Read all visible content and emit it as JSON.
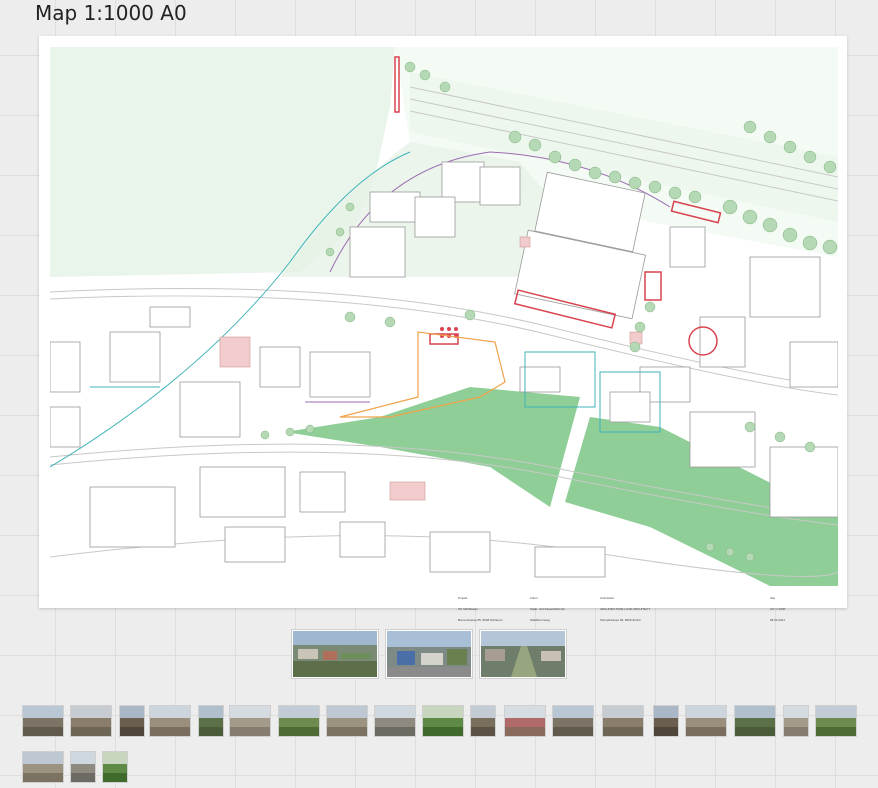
{
  "board": {
    "title": "Map 1:1000 A0"
  },
  "sheet": {
    "title_block": {
      "project": [
        "Projekt",
        "ZG Schiffsoere",
        "Bernerstrasse 85, 8048 Schlieren"
      ],
      "client": [
        "Client",
        "Stadt- und Kaserfabrik AG",
        "Waldbrunnweg"
      ],
      "architect": [
        "Architektur",
        "ARCHITECTURE LOVE ARCHITECT",
        "Schupfstrasse 99, 8050 Zürich"
      ],
      "drawing": [
        "Site",
        "A0 / 1:1000",
        "08.02.2021"
      ]
    }
  },
  "photos_large": [
    {
      "name": "panorama-1"
    },
    {
      "name": "panorama-2"
    },
    {
      "name": "panorama-3"
    }
  ],
  "photos_small_count": 26,
  "colors": {
    "accent_red": "#d9434f",
    "accent_orange": "#f0a24a",
    "accent_teal": "#3fb3b9",
    "park_green": "#8fcf97"
  }
}
